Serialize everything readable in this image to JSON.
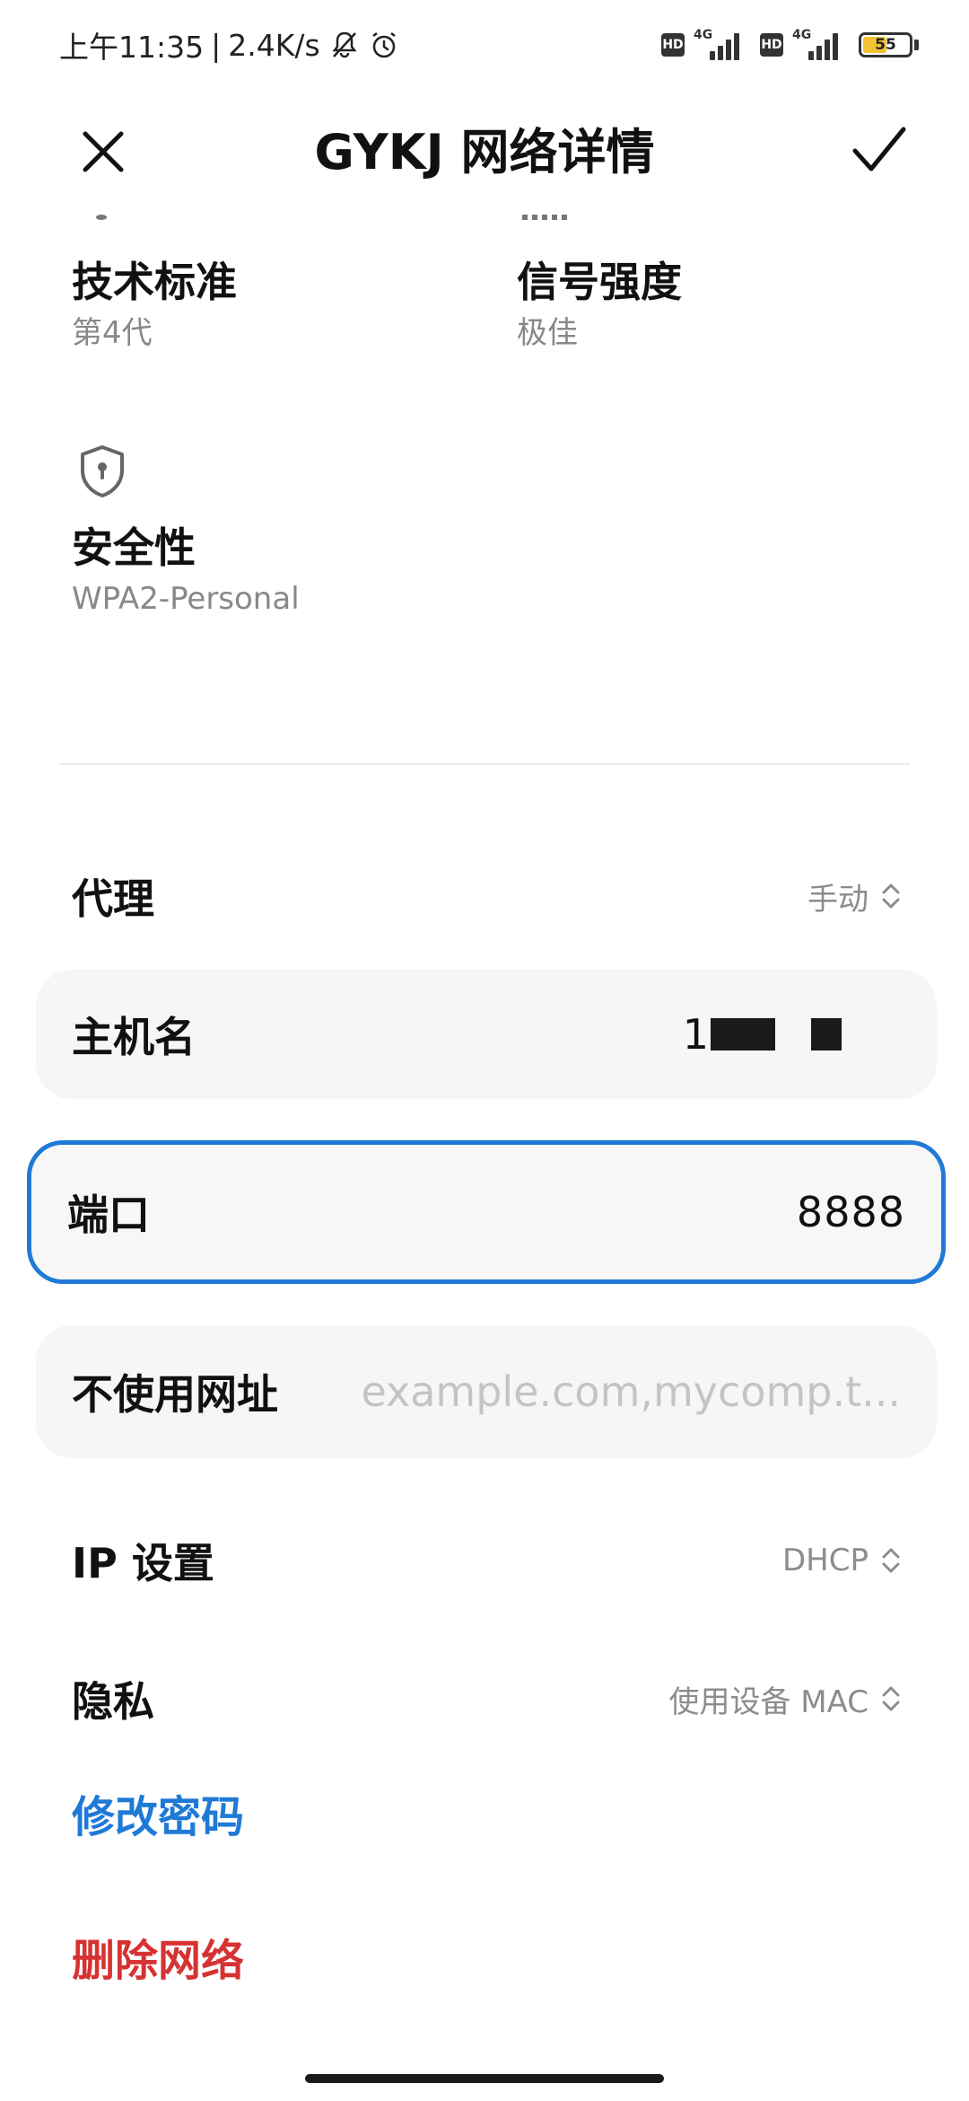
{
  "status_bar": {
    "time": "上午11:35",
    "speed": "2.4K/s",
    "sim1": {
      "hd": "HD",
      "network": "4G"
    },
    "sim2": {
      "hd": "HD",
      "network": "4G"
    },
    "battery_level": "55",
    "battery_color": "#f1c232",
    "icons": [
      "notifications-off-icon",
      "alarm-icon"
    ]
  },
  "header": {
    "title": "GYKJ 网络详情",
    "close_icon": "close-icon",
    "confirm_icon": "check-icon"
  },
  "info": {
    "standard": {
      "label": "技术标准",
      "value": "第4代"
    },
    "signal": {
      "label": "信号强度",
      "value": "极佳"
    },
    "security": {
      "label": "安全性",
      "value": "WPA2-Personal",
      "icon": "shield-icon"
    }
  },
  "proxy": {
    "label": "代理",
    "value": "手动"
  },
  "host": {
    "label": "主机名",
    "value_visible": "1"
  },
  "port": {
    "label": "端口",
    "value": "8888"
  },
  "bypass": {
    "label": "不使用网址",
    "placeholder": "example.com,mycomp.t..."
  },
  "ip": {
    "label": "IP 设置",
    "value": "DHCP"
  },
  "privacy": {
    "label": "隐私",
    "value": "使用设备 MAC"
  },
  "actions": {
    "change_password": "修改密码",
    "change_password_color": "#1f7ad6",
    "delete_network": "删除网络",
    "delete_network_color": "#d63232"
  },
  "accent_color": "#1f7ad6"
}
